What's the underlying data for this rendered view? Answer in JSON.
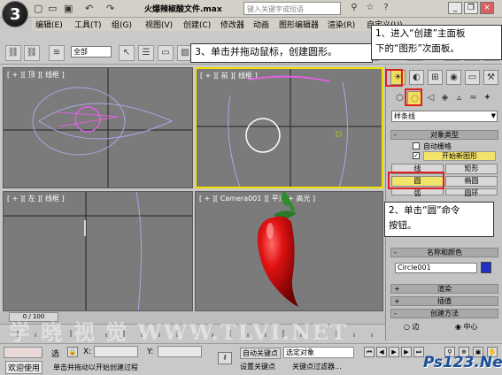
{
  "app": {
    "doc_title": "火爆辣椒酸文件.max",
    "search_placeholder": "键入关键字或短语"
  },
  "menu": [
    "编辑(E)",
    "工具(T)",
    "组(G)",
    "视图(V)",
    "创建(C)",
    "修改器",
    "动画",
    "图形编辑器",
    "渲染(R)",
    "自定义(U)"
  ],
  "toolbar": {
    "selection_filter": "全部"
  },
  "callouts": {
    "step1": "1、进入“创建”主面板\n下的“图形”次面板。",
    "step2": "2、单击“圆”命令\n按钮。",
    "step3": "3、单击并拖动鼠标，创建圆形。"
  },
  "viewports": {
    "top": "[ + ][ 顶 ][ 线框 ]",
    "front": "[ + ][ 前 ][ 线框 ]",
    "left": "[ + ][ 左 ][ 线框 ]",
    "camera": "[ + ][ Camera001 ][ 平滑 + 高光 ]"
  },
  "command_panel": {
    "category_dropdown": "样条线",
    "object_type": {
      "header": "对象类型",
      "autogrid": "自动栅格",
      "start_new_shape": "开始新图形",
      "buttons": [
        "线",
        "矩形",
        "圆",
        "椭圆",
        "弧",
        "圆环"
      ]
    },
    "name_color": {
      "header": "名称和颜色",
      "name_value": "Circle001",
      "swatch_color": "#2030c0"
    },
    "collapsed": [
      "渲染",
      "插值",
      "创建方法"
    ],
    "creation_method": {
      "edge": "边",
      "center": "中心"
    }
  },
  "timeline": {
    "frame": "0 / 100"
  },
  "status": {
    "workspace": "欢迎使用",
    "prompt": "单击并拖动以开始创建过程",
    "x_label": "X:",
    "y_label": "Y:",
    "auto_key": "自动关键点",
    "set_key": "设置关键点",
    "selected": "选定对象",
    "key_filters": "关键点过滤器...",
    "selected_label": "选"
  },
  "watermark": "学 晓 视 觉  WWW.TLVI.NET",
  "logo": "Ps123.Net"
}
